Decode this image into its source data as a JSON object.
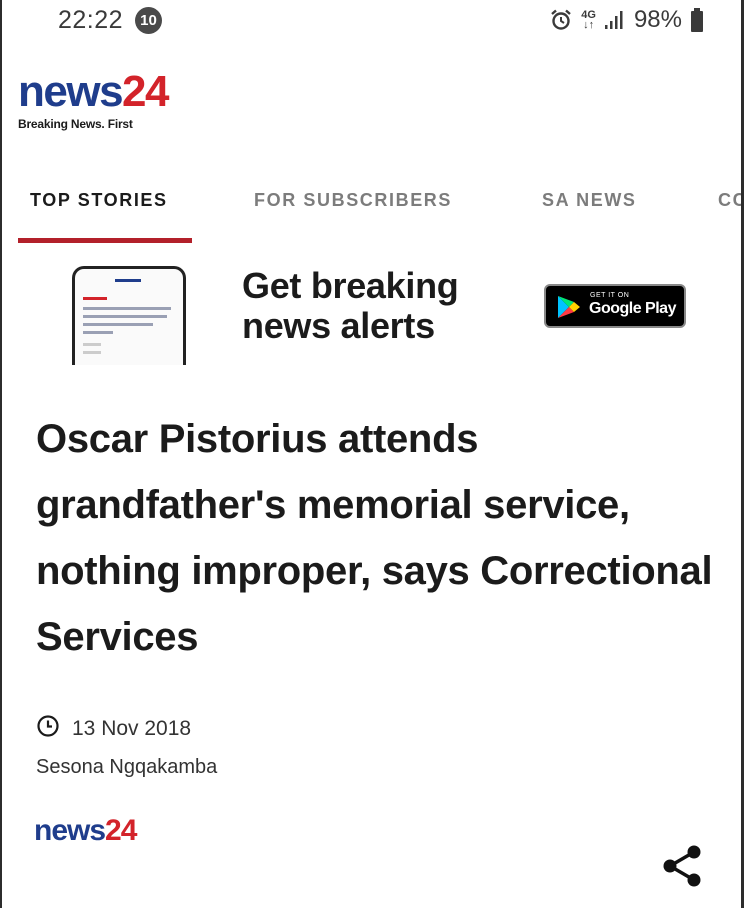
{
  "status_bar": {
    "time": "22:22",
    "notification_count": "10",
    "network": "4G",
    "battery": "98%"
  },
  "logo": {
    "word_news": "news",
    "word_24": "24",
    "tagline": "Breaking News. First"
  },
  "tabs": [
    {
      "label": "TOP STORIES",
      "active": true
    },
    {
      "label": "FOR SUBSCRIBERS",
      "active": false
    },
    {
      "label": "SA NEWS",
      "active": false
    },
    {
      "label": "CC",
      "active": false
    }
  ],
  "banner": {
    "line1": "Get breaking",
    "line2": "news alerts",
    "store_small": "GET IT ON",
    "store_big": "Google Play"
  },
  "article": {
    "headline": "Oscar Pistorius attends grandfather's memorial service, nothing improper, says Correctional Services",
    "date": "13 Nov 2018",
    "author": "Sesona Ngqakamba",
    "source_news": "news",
    "source_24": "24"
  },
  "colors": {
    "brand_blue": "#1f3d8c",
    "brand_red": "#d3232a",
    "tab_underline": "#b3202a"
  },
  "icons": {
    "alarm": "alarm-icon",
    "signal": "signal-icon",
    "battery": "battery-icon",
    "clock": "clock-icon",
    "share": "share-icon",
    "play": "google-play-icon"
  }
}
